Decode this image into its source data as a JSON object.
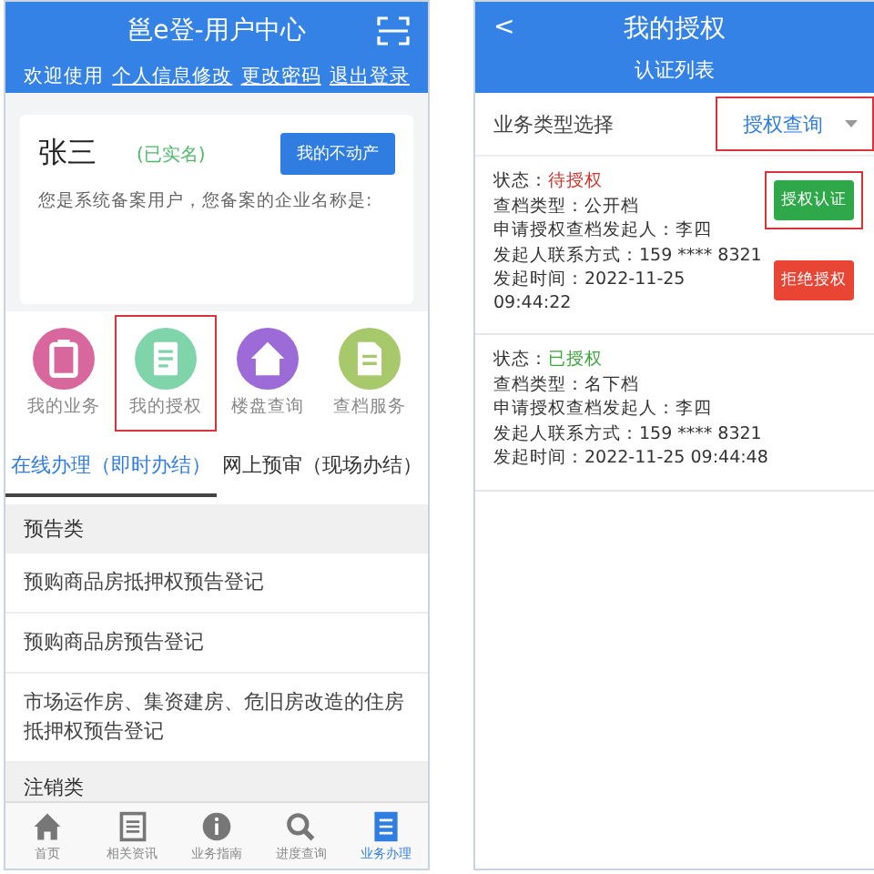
{
  "left": {
    "header": {
      "title": "邕e登-用户中心",
      "links": [
        {
          "label": "欢迎使用",
          "kind": "text"
        },
        {
          "label": "个人信息修改",
          "kind": "link"
        },
        {
          "label": "更改密码",
          "kind": "link"
        },
        {
          "label": "退出登录",
          "kind": "link"
        }
      ]
    },
    "profile": {
      "name": "张三",
      "verified": "(已实名)",
      "button": "我的不动产",
      "note": "您是系统备案用户，您备案的企业名称是:"
    },
    "shortcuts": [
      {
        "label": "我的业务",
        "kind": "clipboard",
        "color": "#d8679d",
        "highlighted": false
      },
      {
        "label": "我的授权",
        "kind": "document",
        "color": "#7fd4a9",
        "highlighted": true
      },
      {
        "label": "楼盘查询",
        "kind": "house",
        "color": "#9c6bd7",
        "highlighted": false
      },
      {
        "label": "查档服务",
        "kind": "file",
        "color": "#a8c86c",
        "highlighted": false
      }
    ],
    "tabs": [
      {
        "label": "在线办理（即时办结）",
        "selected": true
      },
      {
        "label": "网上预审（现场办结）",
        "selected": false
      }
    ],
    "sections": [
      {
        "title": "预告类",
        "items": [
          "预购商品房抵押权预告登记",
          "预购商品房预告登记",
          "市场运作房、集资建房、危旧房改造的住房抵押权预告登记"
        ]
      },
      {
        "title": "注销类"
      }
    ],
    "nav": [
      {
        "label": "首页",
        "kind": "home",
        "selected": false
      },
      {
        "label": "相关资讯",
        "kind": "news",
        "selected": false
      },
      {
        "label": "业务指南",
        "kind": "info",
        "selected": false
      },
      {
        "label": "进度查询",
        "kind": "search",
        "selected": false
      },
      {
        "label": "业务办理",
        "kind": "list",
        "selected": true
      }
    ]
  },
  "right": {
    "header": {
      "back": "<",
      "title": "我的授权",
      "subtitle": "认证列表"
    },
    "filter": {
      "label": "业务类型选择",
      "dropdown": "授权查询",
      "highlighted": true
    },
    "records": [
      {
        "status_label": "状态：",
        "status": "待授权",
        "color": "#d0342c",
        "lines": [
          "查档类型：公开档",
          "申请授权查档发起人：李四",
          "发起人联系方式：159 **** 8321",
          "发起时间：2022-11-25 09:44:22"
        ],
        "actions": [
          {
            "label": "授权认证",
            "kind": "accept",
            "highlighted": true
          },
          {
            "label": "拒绝授权",
            "kind": "reject",
            "highlighted": false
          }
        ]
      },
      {
        "status_label": "状态：",
        "status": "已授权",
        "color": "#3aa63a",
        "lines": [
          "查档类型：名下档",
          "申请授权查档发起人：李四",
          "发起人联系方式：159 **** 8321",
          "发起时间：2022-11-25 09:44:48"
        ]
      }
    ]
  }
}
